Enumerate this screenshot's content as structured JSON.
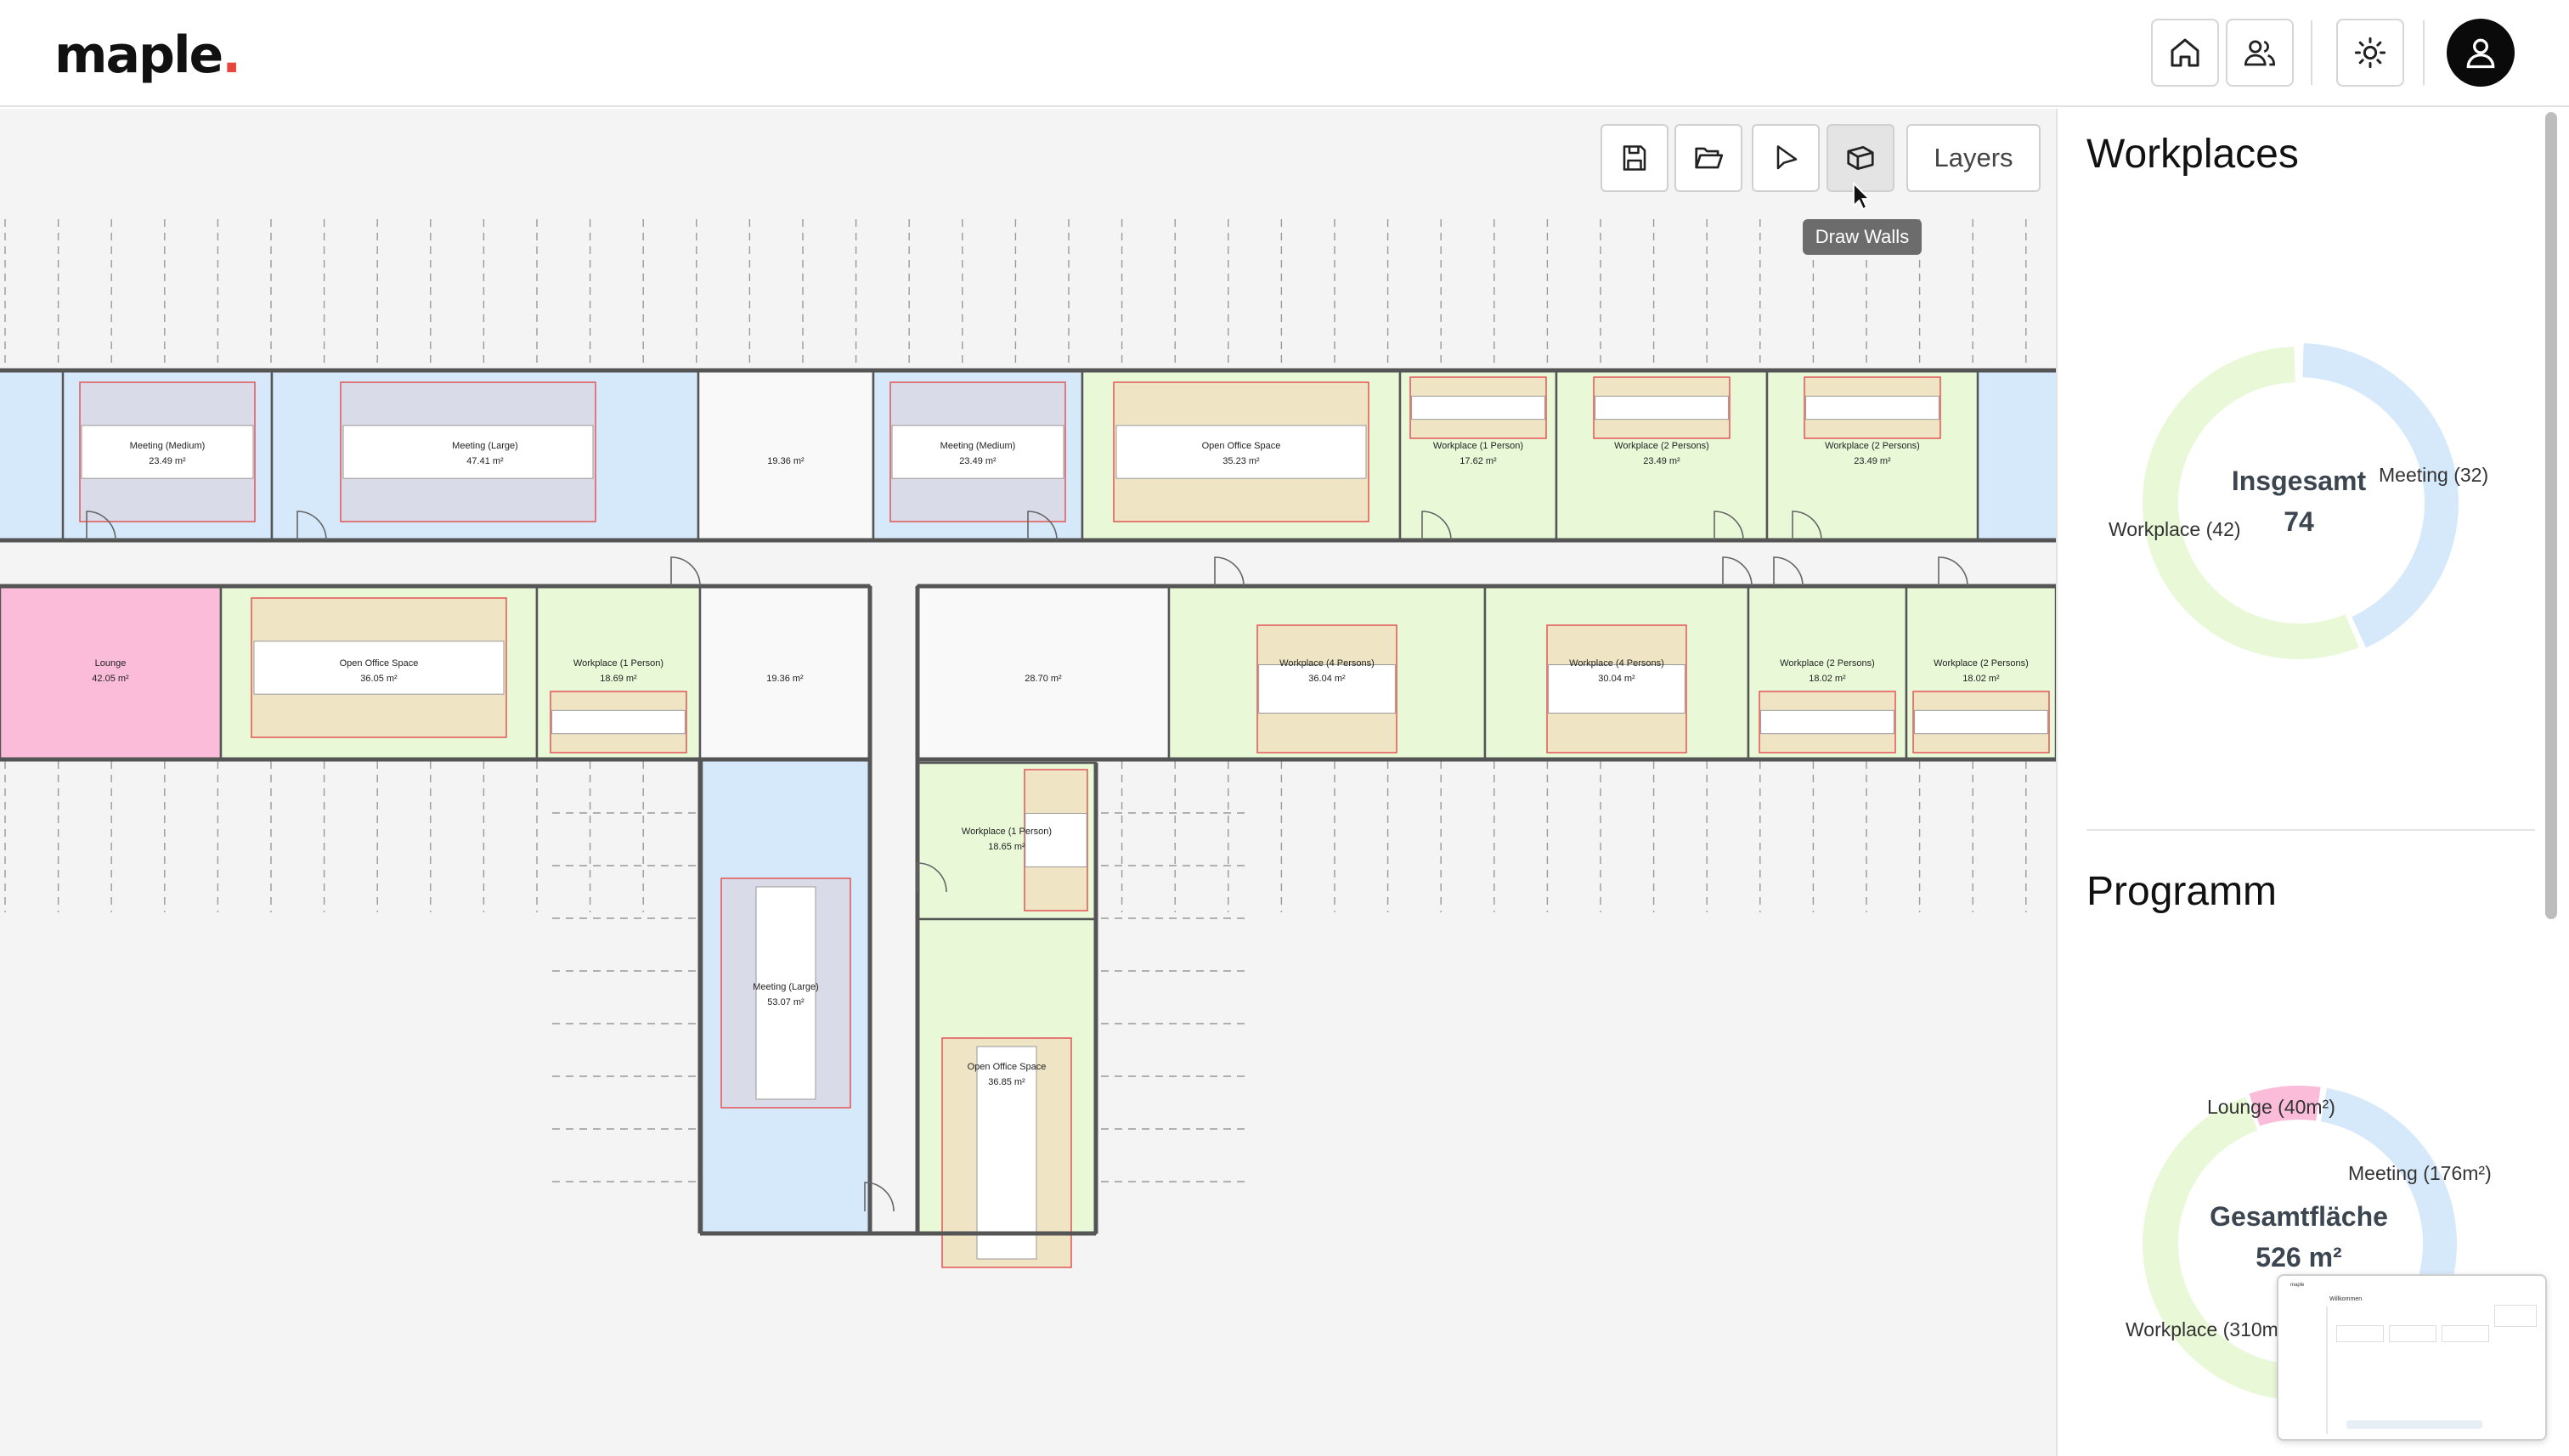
{
  "app": {
    "name": "maple"
  },
  "topbar": {
    "icons": [
      "home-icon",
      "users-icon",
      "sun-icon",
      "user-icon"
    ]
  },
  "toolbar": {
    "tools": [
      "save-icon",
      "folder-open-icon",
      "pointer-icon",
      "draw-walls-icon"
    ],
    "layers_label": "Layers",
    "tooltip": "Draw Walls"
  },
  "floorplan": {
    "rooms": [
      {
        "name": "Meeting (Medium)",
        "area": "23.49 m²",
        "type": "meeting"
      },
      {
        "name": "Meeting (Large)",
        "area": "47.41 m²",
        "type": "meeting"
      },
      {
        "name": "",
        "area": "19.36 m²",
        "type": "none"
      },
      {
        "name": "Meeting (Medium)",
        "area": "23.49 m²",
        "type": "meeting"
      },
      {
        "name": "Open Office Space",
        "area": "35.23 m²",
        "type": "workplace"
      },
      {
        "name": "Workplace (1 Person)",
        "area": "17.62 m²",
        "type": "workplace"
      },
      {
        "name": "Workplace (2 Persons)",
        "area": "23.49 m²",
        "type": "workplace"
      },
      {
        "name": "Workplace (2 Persons)",
        "area": "23.49 m²",
        "type": "workplace"
      },
      {
        "name": "Lounge",
        "area": "42.05 m²",
        "type": "lounge"
      },
      {
        "name": "Open Office Space",
        "area": "36.05 m²",
        "type": "workplace"
      },
      {
        "name": "Workplace (1 Person)",
        "area": "18.69 m²",
        "type": "workplace"
      },
      {
        "name": "",
        "area": "19.36 m²",
        "type": "none"
      },
      {
        "name": "",
        "area": "28.70 m²",
        "type": "none"
      },
      {
        "name": "Workplace (4 Persons)",
        "area": "36.04 m²",
        "type": "workplace"
      },
      {
        "name": "Workplace (4 Persons)",
        "area": "30.04 m²",
        "type": "workplace"
      },
      {
        "name": "Workplace (2 Persons)",
        "area": "18.02 m²",
        "type": "workplace"
      },
      {
        "name": "Workplace (2 Persons)",
        "area": "18.02 m²",
        "type": "workplace"
      },
      {
        "name": "Workplace (1 Person)",
        "area": "18.65 m²",
        "type": "workplace"
      },
      {
        "name": "Meeting (Large)",
        "area": "53.07 m²",
        "type": "meeting"
      },
      {
        "name": "Open Office Space",
        "area": "36.85 m²",
        "type": "workplace"
      }
    ]
  },
  "colors": {
    "meeting": "#d6e9fb",
    "workplace": "#e9f9d8",
    "lounge": "#fbbcda",
    "wall": "#555555",
    "desk_fill": "#efe5c4",
    "meeting_desk_fill": "#dadbe8",
    "desk_outline": "#e25555"
  },
  "sidebar": {
    "workplaces": {
      "title": "Workplaces",
      "center_title": "Insgesamt",
      "center_value": "74",
      "segments": [
        {
          "label": "Meeting (32)",
          "value": 32,
          "color": "#d6e9fb"
        },
        {
          "label": "Workplace (42)",
          "value": 42,
          "color": "#e9f9d8"
        }
      ]
    },
    "programm": {
      "title": "Programm",
      "center_title": "Gesamtfläche",
      "center_value": "526 m²",
      "segments": [
        {
          "label": "Lounge (40m²)",
          "value": 40,
          "color": "#fbbcda"
        },
        {
          "label": "Meeting (176m²)",
          "value": 176,
          "color": "#d6e9fb"
        },
        {
          "label": "Workplace (310m²",
          "value": 310,
          "color": "#e9f9d8"
        }
      ]
    }
  },
  "thumbnail": {
    "title": "Willkommen"
  }
}
